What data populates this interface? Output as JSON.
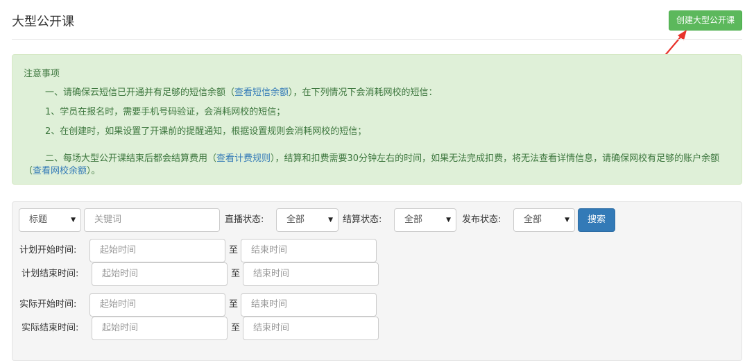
{
  "page": {
    "title": "大型公开课",
    "create_button": "创建大型公开课"
  },
  "notice": {
    "title": "注意事项",
    "line1_pre": "一、请确保云短信已开通并有足够的短信余额（",
    "line1_link": "查看短信余额",
    "line1_post": "），在下列情况下会消耗网校的短信：",
    "line2": "1、学员在报名时，需要手机号码验证，会消耗网校的短信；",
    "line3": "2、在创建时，如果设置了开课前的提醒通知，根据设置规则会消耗网校的短信；",
    "line4_pre": "二、每场大型公开课结束后都会结算费用（",
    "line4_link1": "查看计费规则",
    "line4_mid": "），结算和扣费需要30分钟左右的时间，如果无法完成扣费，将无法查看详情信息，请确保网校有足够的账户余额（",
    "line4_link2": "查看网校余额",
    "line4_post": "）。"
  },
  "filter": {
    "field_select": "标题",
    "keyword_placeholder": "关键词",
    "live_status_label": "直播状态:",
    "live_status_value": "全部",
    "settle_status_label": "结算状态:",
    "settle_status_value": "全部",
    "publish_status_label": "发布状态:",
    "publish_status_value": "全部",
    "search_button": "搜索",
    "to": "至",
    "start_placeholder": "起始时间",
    "end_placeholder": "结束时间",
    "plan_start_label": "计划开始时间:",
    "plan_end_label": "计划结束时间:",
    "actual_start_label": "实际开始时间:",
    "actual_end_label": "实际结束时间:"
  },
  "icons": {
    "caret": "caret-down-icon",
    "annotation": "red-arrow-annotation"
  },
  "colors": {
    "success": "#5cb85c",
    "primary": "#337ab7",
    "notice_bg": "#dff0d8",
    "arrow": "#e8322b"
  }
}
